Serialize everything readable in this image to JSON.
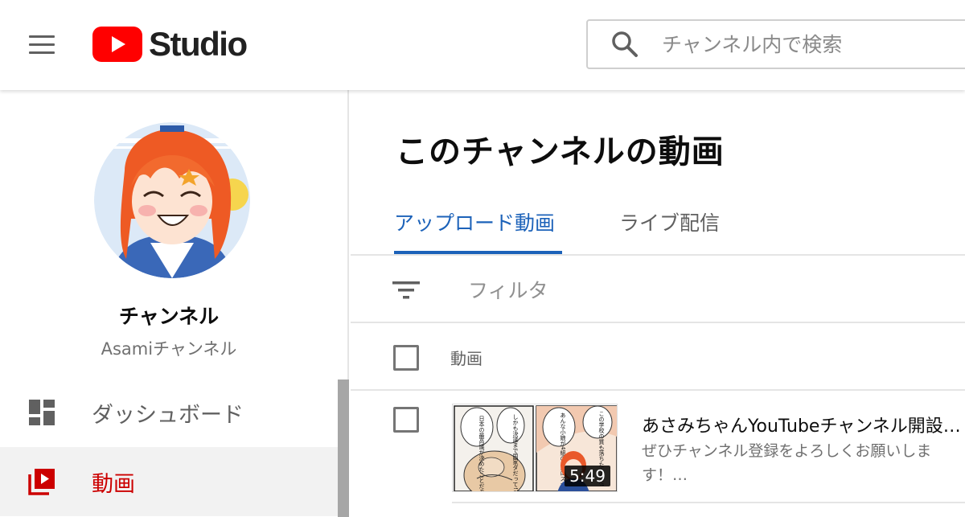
{
  "header": {
    "logo_text": "Studio",
    "search_placeholder": "チャンネル内で検索",
    "brand_color": "#ff0000"
  },
  "sidebar": {
    "channel_title": "チャンネル",
    "channel_name": "Asamiチャンネル",
    "items": [
      {
        "label": "ダッシュボード",
        "icon": "dashboard-icon",
        "active": false
      },
      {
        "label": "動画",
        "icon": "video-library-icon",
        "active": true,
        "color": "#cc0000"
      }
    ]
  },
  "main": {
    "title": "このチャンネルの動画",
    "tabs": [
      {
        "label": "アップロード動画",
        "active": true,
        "color": "#1c62b9"
      },
      {
        "label": "ライブ配信",
        "active": false
      }
    ],
    "filter_label": "フィルタ",
    "table": {
      "column_video": "動画",
      "rows": [
        {
          "title": "あさみちゃんYouTubeチャンネル開設…",
          "description": "ぜひチャンネル登録をよろしくお願いします！…",
          "duration": "5:49",
          "thumbnail_text": {
            "bubble_1": "日本の最高議が決めたことだぞ！",
            "bubble_2": "しかも決議まで国家ダだって!?",
            "bubble_3": "あんな小娘が4組の9人にスポンサー",
            "bubble_4": "この学校の質も落ちたもんだ!"
          }
        }
      ]
    }
  }
}
